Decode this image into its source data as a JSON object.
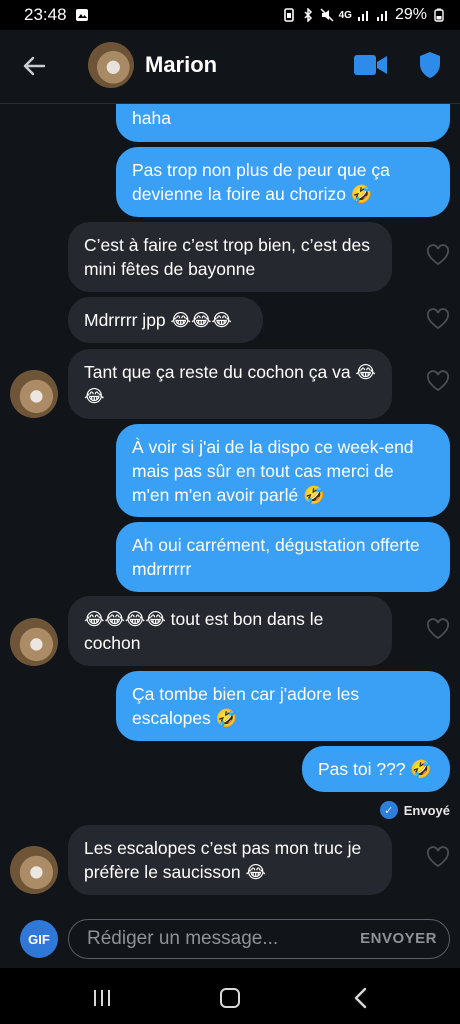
{
  "status_bar": {
    "time": "23:48",
    "battery": "29%",
    "network": "4G"
  },
  "header": {
    "contact_name": "Marion",
    "icons": [
      "back-arrow-icon",
      "video-call-icon",
      "shield-icon"
    ]
  },
  "messages": [
    {
      "dir": "out",
      "text": "haha"
    },
    {
      "dir": "out",
      "text": "Pas trop non plus de peur que ça devienne la foire au chorizo 🤣"
    },
    {
      "dir": "in",
      "text": "C’est à faire c’est trop bien, c’est des mini fêtes de bayonne"
    },
    {
      "dir": "in",
      "text": "Mdrrrrr jpp 😂😂😂"
    },
    {
      "dir": "in",
      "text": "Tant que ça reste du cochon ça va 😂😂"
    },
    {
      "dir": "out",
      "text": "À voir si j'ai de la dispo ce week-end mais pas sûr en tout cas merci de m'en m'en avoir parlé 🤣"
    },
    {
      "dir": "out",
      "text": "Ah oui carrément, dégustation offerte mdrrrrrr"
    },
    {
      "dir": "in",
      "text": "😂😂😂😂 tout est bon dans le cochon"
    },
    {
      "dir": "out",
      "text": "Ça tombe bien car j'adore les escalopes 🤣"
    },
    {
      "dir": "out",
      "text": "Pas toi ??? 🤣"
    },
    {
      "dir": "in",
      "text": "Les escalopes c’est pas mon truc je préfère le saucisson 😂"
    }
  ],
  "delivery_status": "Envoyé",
  "composer": {
    "gif_label": "GIF",
    "placeholder": "Rédiger un message...",
    "send_label": "ENVOYER"
  },
  "colors": {
    "outgoing": "#3aa0f5",
    "incoming": "#25282e",
    "background": "#111418",
    "accent": "#2f78d8"
  }
}
